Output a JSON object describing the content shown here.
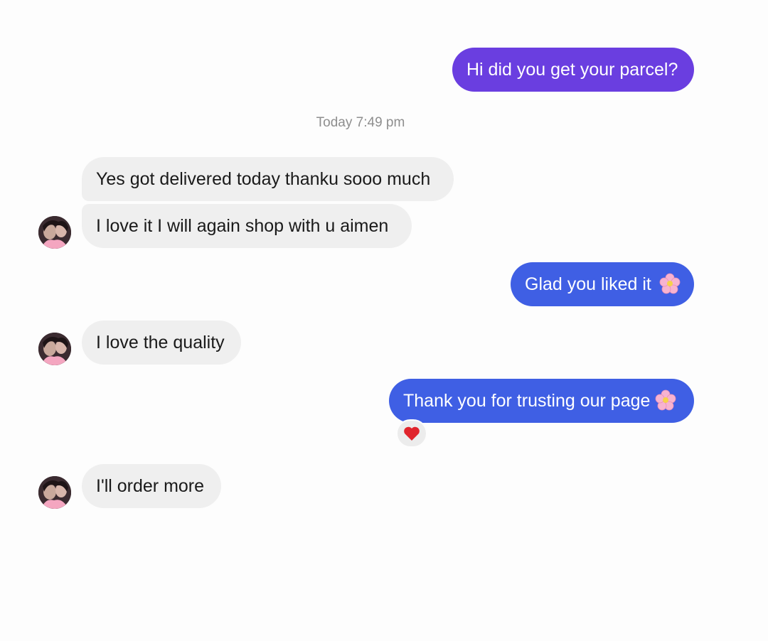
{
  "conversation": {
    "timestamp": "Today 7:49 pm",
    "messages": [
      {
        "id": "m1",
        "direction": "outgoing",
        "text": "Hi did you get your parcel?"
      },
      {
        "id": "m2",
        "direction": "incoming",
        "text": "Yes got delivered today thanku sooo much"
      },
      {
        "id": "m3",
        "direction": "incoming",
        "text": "I love it I will again shop with u aimen"
      },
      {
        "id": "m4",
        "direction": "outgoing",
        "text": "Glad you liked it",
        "emoji": "cherry-blossom-icon"
      },
      {
        "id": "m5",
        "direction": "incoming",
        "text": "I love the quality"
      },
      {
        "id": "m6",
        "direction": "outgoing",
        "text": "Thank you for trusting our page",
        "emoji": "cherry-blossom-icon",
        "reaction": "heart-icon"
      },
      {
        "id": "m7",
        "direction": "incoming",
        "text": "I'll order more"
      }
    ]
  },
  "colors": {
    "outgoing_first": "#6a3ee0",
    "outgoing": "#3f5fe4",
    "incoming": "#efefef",
    "reaction_heart": "#e0242c"
  }
}
